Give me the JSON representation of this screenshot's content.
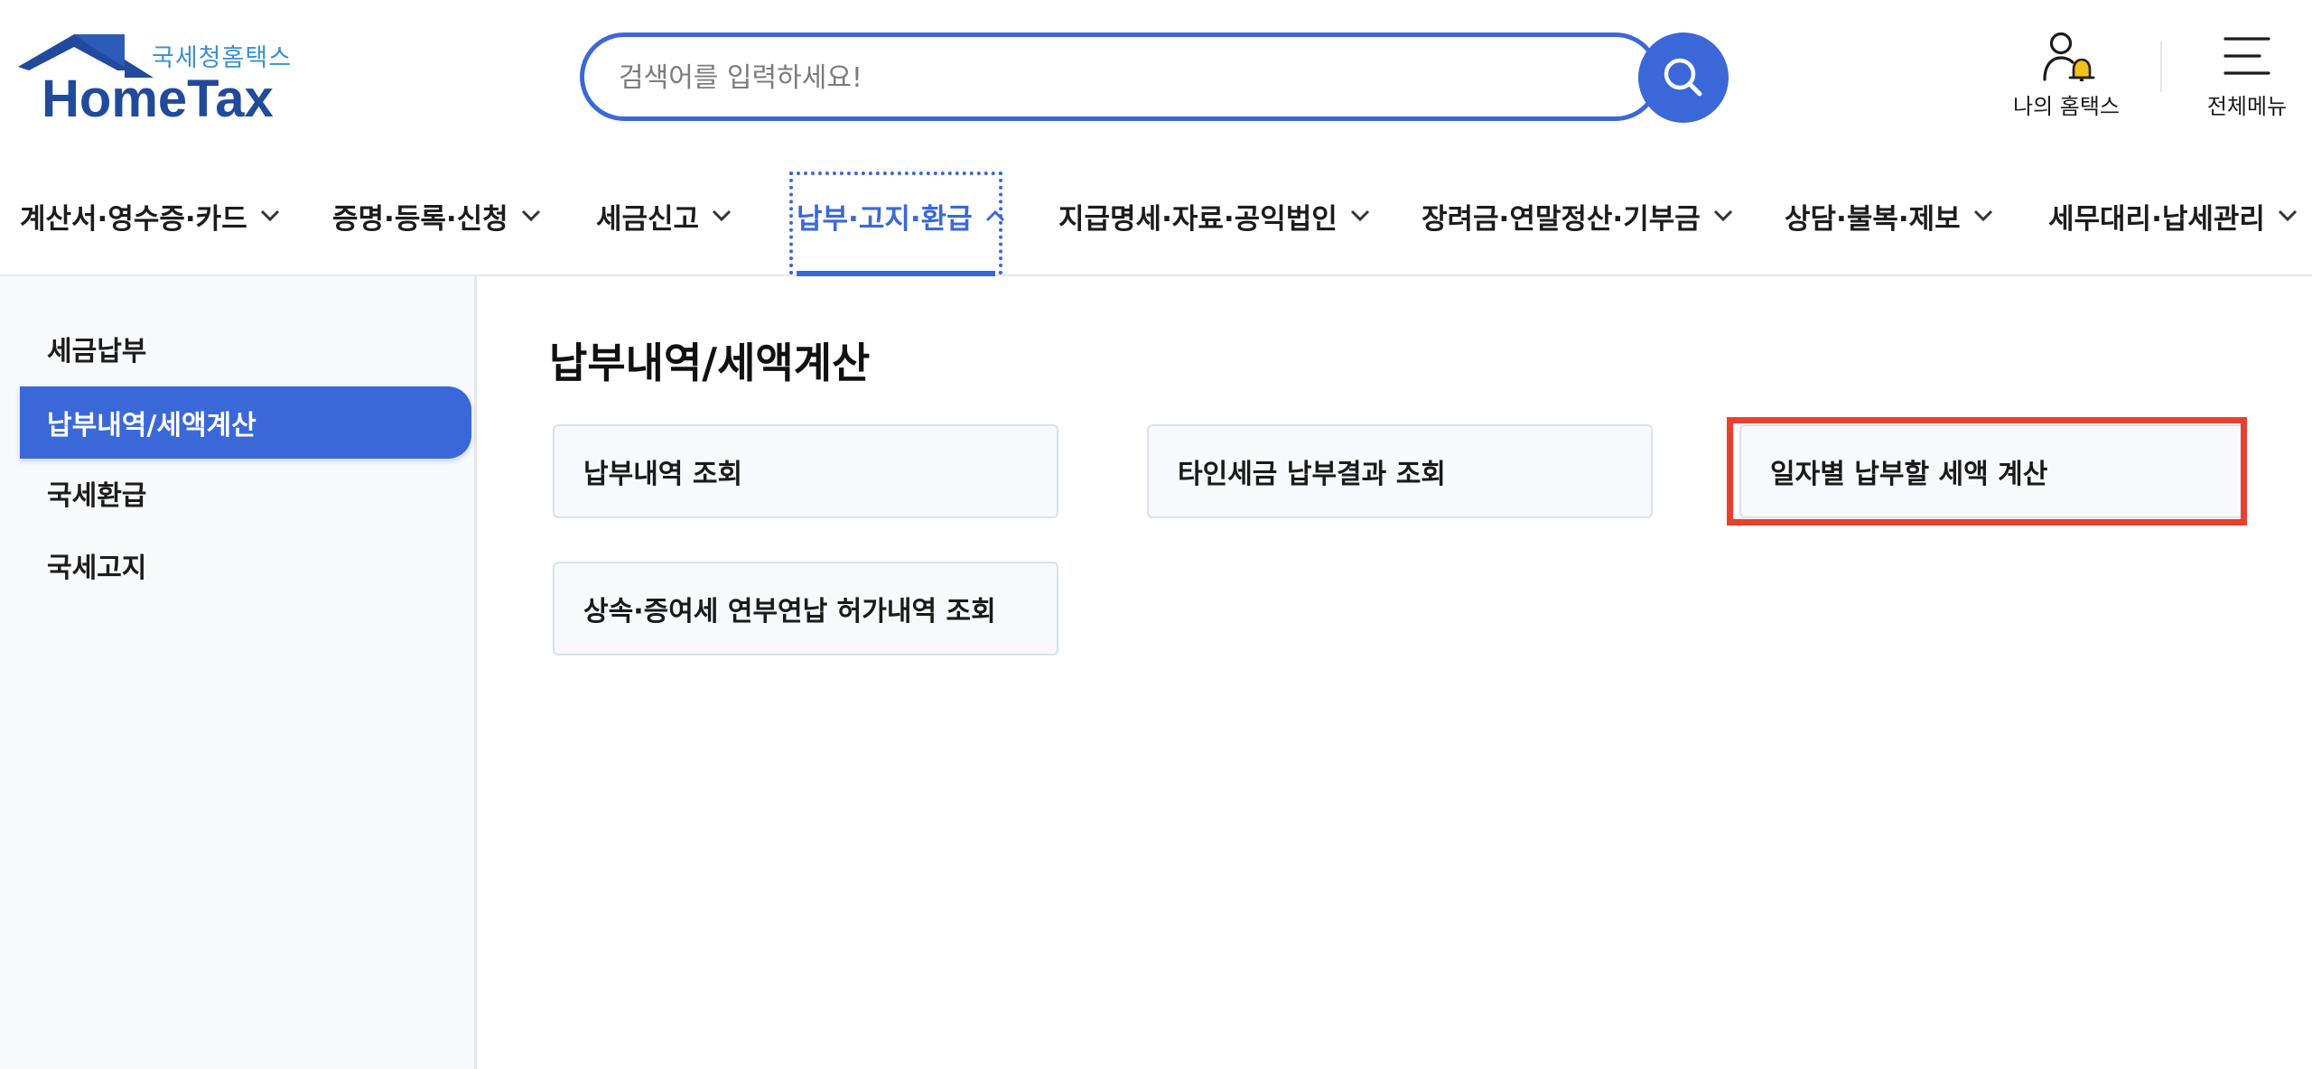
{
  "brand": {
    "sub_title": "국세청홈택스",
    "main_title": "HomeTax"
  },
  "search": {
    "placeholder": "검색어를 입력하세요!",
    "icon": "search-icon"
  },
  "utility": {
    "my_hometax": "나의 홈택스",
    "all_menu": "전체메뉴"
  },
  "gnb": {
    "items": [
      {
        "label": "계산서·영수증·카드"
      },
      {
        "label": "증명·등록·신청"
      },
      {
        "label": "세금신고"
      },
      {
        "label": "납부·고지·환급",
        "active": true
      },
      {
        "label": "지급명세·자료·공익법인"
      },
      {
        "label": "장려금·연말정산·기부금"
      },
      {
        "label": "상담·불복·제보"
      },
      {
        "label": "세무대리·납세관리"
      }
    ]
  },
  "sidebar": {
    "items": [
      {
        "label": "세금납부"
      },
      {
        "label": "납부내역/세액계산",
        "active": true
      },
      {
        "label": "국세환급"
      },
      {
        "label": "국세고지"
      }
    ]
  },
  "main": {
    "title": "납부내역/세액계산",
    "cards": [
      {
        "label": "납부내역 조회"
      },
      {
        "label": "타인세금 납부결과 조회"
      },
      {
        "label": "일자별 납부할 세액 계산",
        "highlighted": true
      },
      {
        "label": "상속·증여세 연부연납 허가내역 조회"
      }
    ]
  },
  "colors": {
    "accent": "#3b68d8",
    "brand_navy": "#214a9c",
    "brand_sub": "#3a8ed3",
    "highlight": "#e8402c",
    "bell": "#f2c21b"
  }
}
